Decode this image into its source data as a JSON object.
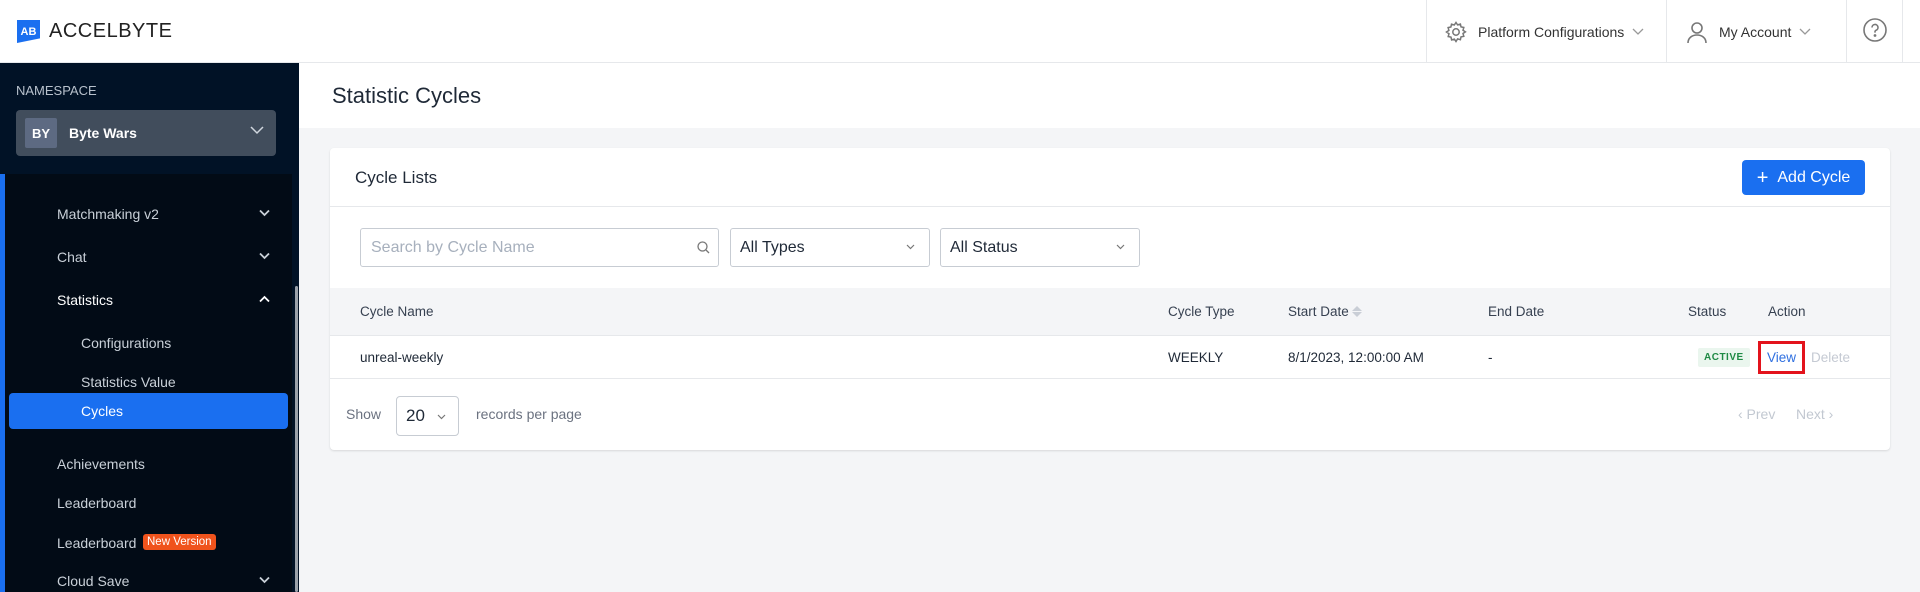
{
  "header": {
    "logo_mark": "AB",
    "brand": "ACCELBYTE",
    "platform_config": {
      "label": "Platform Configurations",
      "icon": "gear-icon"
    },
    "account": {
      "label": "My Account",
      "icon": "user-icon"
    },
    "help_icon": "help-circle-icon"
  },
  "sidebar": {
    "namespace_label": "NAMESPACE",
    "namespace": {
      "badge": "BY",
      "name": "Byte Wars"
    },
    "items": [
      {
        "label": "Matchmaking v2",
        "expandable": true,
        "expanded": false
      },
      {
        "label": "Chat",
        "expandable": true,
        "expanded": false
      },
      {
        "label": "Statistics",
        "expandable": true,
        "expanded": true
      },
      {
        "label": "Configurations",
        "sub": true
      },
      {
        "label": "Statistics Value",
        "sub": true
      },
      {
        "label": "Cycles",
        "sub": true,
        "active": true
      },
      {
        "label": "Achievements"
      },
      {
        "label": "Leaderboard"
      },
      {
        "label": "Leaderboard",
        "badge": "New Version"
      },
      {
        "label": "Cloud Save",
        "expandable": true,
        "expanded": false
      }
    ]
  },
  "page": {
    "title": "Statistic Cycles",
    "card_title": "Cycle Lists",
    "add_button": "Add Cycle",
    "filters": {
      "search_placeholder": "Search by Cycle Name",
      "type_selected": "All Types",
      "status_selected": "All Status"
    },
    "table": {
      "columns": [
        "Cycle Name",
        "Cycle Type",
        "Start Date",
        "End Date",
        "Status",
        "Action"
      ],
      "rows": [
        {
          "name": "unreal-weekly",
          "type": "WEEKLY",
          "start": "8/1/2023, 12:00:00 AM",
          "end": "-",
          "status": "ACTIVE",
          "actions": [
            "View",
            "Delete"
          ]
        }
      ]
    },
    "pagination": {
      "show_label": "Show",
      "per_page": "20",
      "per_page_label": "records per page",
      "prev": "‹ Prev",
      "next": "Next ›"
    }
  },
  "colors": {
    "accent": "#1a6ff0",
    "sidebar_bg": "#011226",
    "status_active": "#1e8a44",
    "highlight_box": "#e3131c",
    "new_badge": "#f0531c"
  }
}
